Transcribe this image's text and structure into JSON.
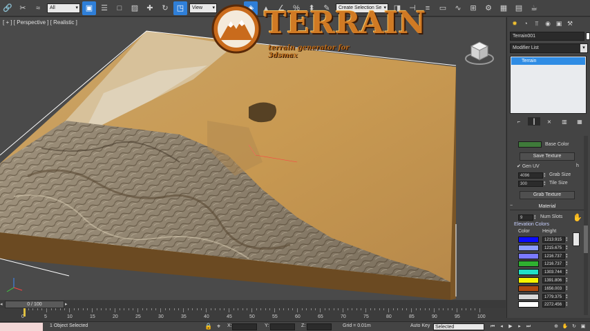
{
  "toolbar": {
    "filter_dropdown": "All",
    "view_dropdown": "View",
    "selection_set_dropdown": "Create Selection Se"
  },
  "viewport": {
    "label": "[ + ] [ Perspective ] [ Realistic ]"
  },
  "logo": {
    "word": "TERRAIN",
    "subtitle": "terrain generator for 3dsmax"
  },
  "panel": {
    "object_name": "Terrain001",
    "modifier_list": "Modifier List",
    "stack_item": "Terrain",
    "base_color_label": "Base Color",
    "base_color": "#3f7a3a",
    "save_texture": "Save Texture",
    "gen_uv": "Gen UV",
    "grab_size_value": "4096",
    "grab_size_label": "Grab Size",
    "tile_size_value": "300",
    "tile_size_label": "Tile Size",
    "grab_texture": "Grab Texture",
    "material_header": "Material",
    "num_slots_value": "9",
    "num_slots_label": "Num Slots",
    "elevation_header": "Elevation Colors",
    "col_color": "Color",
    "col_height": "Height",
    "elevation": [
      {
        "color": "#0b0bff",
        "height": "1213.915"
      },
      {
        "color": "#8c9cff",
        "height": "1215.675"
      },
      {
        "color": "#7a7aff",
        "height": "1216.737"
      },
      {
        "color": "#2fb030",
        "height": "1216.737"
      },
      {
        "color": "#1fe0c8",
        "height": "1303.744"
      },
      {
        "color": "#f5f500",
        "height": "1391.806"
      },
      {
        "color": "#b04a10",
        "height": "1656.003"
      },
      {
        "color": "#d8d8d8",
        "height": "1779.375"
      },
      {
        "color": "#ffffff",
        "height": "2272.456"
      }
    ]
  },
  "timeline": {
    "frame": "0 / 100",
    "ticks": [
      "0",
      "5",
      "10",
      "15",
      "20",
      "25",
      "30",
      "35",
      "40",
      "45",
      "50",
      "55",
      "60",
      "65",
      "70",
      "75",
      "80",
      "85",
      "90",
      "95",
      "100"
    ]
  },
  "status": {
    "selection": "1 Object Selected",
    "x_label": "X:",
    "y_label": "Y:",
    "z_label": "Z:",
    "grid": "Grid = 0.01m",
    "auto_key": "Auto Key",
    "selected": "Selected"
  }
}
